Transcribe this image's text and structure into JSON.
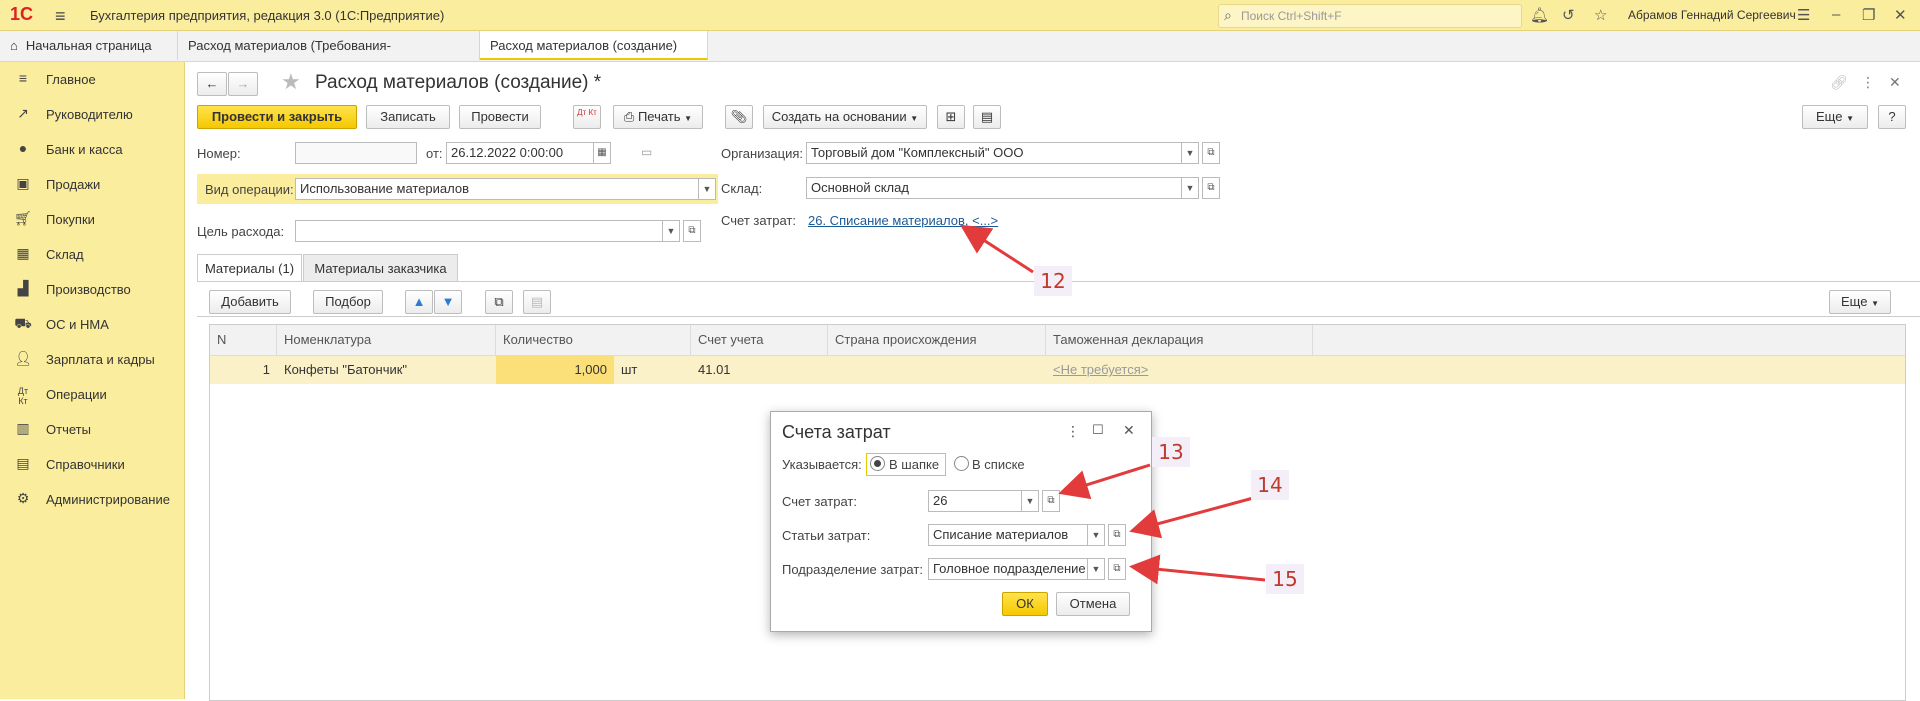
{
  "app": {
    "logo": "1С",
    "title": "Бухгалтерия предприятия, редакция 3.0  (1С:Предприятие)",
    "search_placeholder": "Поиск Ctrl+Shift+F",
    "user": "Абрамов Геннадий Сергеевич"
  },
  "tabs": [
    {
      "label": "Начальная страница"
    },
    {
      "label": "Расход материалов (Требования-накладные)",
      "close": "×"
    },
    {
      "label": "Расход материалов (создание) *",
      "close": "×"
    }
  ],
  "sidebar": {
    "items": [
      {
        "label": "Главное",
        "icon": "menu-icon"
      },
      {
        "label": "Руководителю",
        "icon": "trend-icon"
      },
      {
        "label": "Банк и касса",
        "icon": "coin-icon"
      },
      {
        "label": "Продажи",
        "icon": "bag-icon"
      },
      {
        "label": "Покупки",
        "icon": "cart-icon"
      },
      {
        "label": "Склад",
        "icon": "grid-icon"
      },
      {
        "label": "Производство",
        "icon": "factory-icon"
      },
      {
        "label": "ОС и НМА",
        "icon": "truck-icon"
      },
      {
        "label": "Зарплата и кадры",
        "icon": "person-icon"
      },
      {
        "label": "Операции",
        "icon": "dt-kt-icon"
      },
      {
        "label": "Отчеты",
        "icon": "bar-chart-icon"
      },
      {
        "label": "Справочники",
        "icon": "book-icon"
      },
      {
        "label": "Администрирование",
        "icon": "gear-icon"
      }
    ]
  },
  "doc": {
    "title": "Расход материалов (создание) *",
    "toolbar": {
      "post_close": "Провести и закрыть",
      "save": "Записать",
      "post": "Провести",
      "dtkt": "Дт Кт",
      "print": "Печать",
      "create_based": "Создать на основании",
      "more": "Еще",
      "help": "?"
    },
    "number_label": "Номер:",
    "number_value": "",
    "date_label": "от:",
    "date_value": "26.12.2022  0:00:00",
    "op_label": "Вид операции:",
    "op_value": "Использование материалов",
    "purpose_label": "Цель расхода:",
    "purpose_value": "",
    "org_label": "Организация:",
    "org_value": "Торговый дом \"Комплексный\" ООО",
    "warehouse_label": "Склад:",
    "warehouse_value": "Основной склад",
    "cost_account_label": "Счет затрат:",
    "cost_account_link": "26. Списание материалов, <...>",
    "inner_tabs": [
      "Материалы (1)",
      "Материалы заказчика"
    ],
    "table_toolbar": {
      "add": "Добавить",
      "pick": "Подбор",
      "more": "Еще"
    },
    "table": {
      "columns": [
        "N",
        "Номенклатура",
        "Количество",
        "Счет учета",
        "Страна происхождения",
        "Таможенная декларация"
      ],
      "rows": [
        {
          "n": "1",
          "item": "Конфеты \"Батончик\"",
          "qty": "1,000",
          "unit": "шт",
          "account": "41.01",
          "country": "",
          "declaration": "<Не требуется>"
        }
      ]
    }
  },
  "dialog": {
    "title": "Счета затрат",
    "shown_label": "Указывается:",
    "radio_header": "В шапке",
    "radio_list": "В списке",
    "account_label": "Счет затрат:",
    "account_value": "26",
    "items_label": "Статьи затрат:",
    "items_value": "Списание материалов",
    "division_label": "Подразделение затрат:",
    "division_value": "Головное подразделение",
    "ok": "ОК",
    "cancel": "Отмена"
  },
  "callouts": [
    "12",
    "13",
    "14",
    "15"
  ]
}
